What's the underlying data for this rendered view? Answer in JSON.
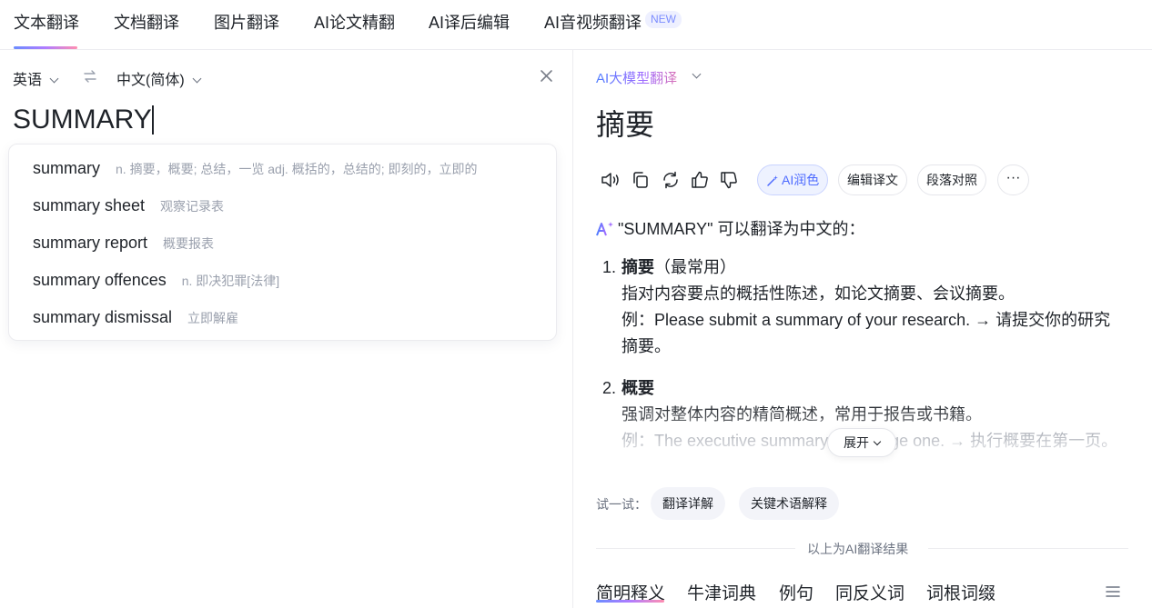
{
  "nav": {
    "tabs": [
      {
        "label": "文本翻译"
      },
      {
        "label": "文档翻译"
      },
      {
        "label": "图片翻译"
      },
      {
        "label": "AI论文精翻"
      },
      {
        "label": "AI译后编辑"
      },
      {
        "label": "AI音视频翻译"
      }
    ],
    "new_badge": "NEW"
  },
  "source": {
    "from_lang": "英语",
    "to_lang": "中文(简体)",
    "input_value": "SUMMARY"
  },
  "suggestions": [
    {
      "term": "summary",
      "gloss": "n. 摘要，概要; 总结，一览 adj. 概括的，总结的; 即刻的，立即的"
    },
    {
      "term": "summary sheet",
      "gloss": "观察记录表"
    },
    {
      "term": "summary report",
      "gloss": "概要报表"
    },
    {
      "term": "summary offences",
      "gloss": "n. 即决犯罪[法律]"
    },
    {
      "term": "summary dismissal",
      "gloss": "立即解雇"
    }
  ],
  "result": {
    "model_label": "AI大模型翻译",
    "main": "摘要",
    "tools": {
      "ai_polish": "AI润色",
      "edit": "编辑译文",
      "parallel": "段落对照",
      "more": "···"
    },
    "ai_heading": "\"SUMMARY\" 可以翻译为中文的：",
    "items": [
      {
        "num": "1.",
        "term": "摘要",
        "note": "（最常用）",
        "desc": "指对内容要点的概括性陈述，如论文摘要、会议摘要。",
        "example": "例：Please submit a summary of your research. → 请提交你的研究摘要。"
      },
      {
        "num": "2.",
        "term": "概要",
        "note": "",
        "desc": "强调对整体内容的精简概述，常用于报告或书籍。",
        "example": "例：The executive summary is on page one. → 执行概要在第一页。"
      }
    ],
    "expand_label": "展开",
    "try_label": "试一试：",
    "try_buttons": [
      "翻译详解",
      "关键术语解释"
    ],
    "footer_note": "以上为AI翻译结果"
  },
  "dict_tabs": [
    "简明释义",
    "牛津词典",
    "例句",
    "同反义词",
    "词根词缀"
  ],
  "colors": {
    "accent_gradient_start": "#6a8cff",
    "accent_gradient_end": "#ff8fb1",
    "ai_blue": "#4e6bff"
  }
}
